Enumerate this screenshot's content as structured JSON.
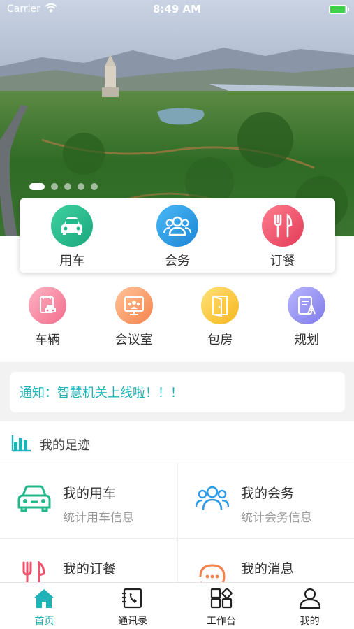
{
  "status_bar": {
    "carrier": "Carrier",
    "time": "8:49 AM"
  },
  "banner": {
    "slide_count": 5,
    "active_slide": 1
  },
  "main_services": [
    {
      "label": "用车",
      "icon": "car-icon",
      "color": "#22b98a"
    },
    {
      "label": "会务",
      "icon": "people-icon",
      "color": "#2d9ce8"
    },
    {
      "label": "订餐",
      "icon": "utensils-icon",
      "color": "#f0506a"
    }
  ],
  "sub_services": [
    {
      "label": "车辆",
      "icon": "vehicle-icon"
    },
    {
      "label": "会议室",
      "icon": "meeting-room-icon"
    },
    {
      "label": "包房",
      "icon": "door-icon"
    },
    {
      "label": "规划",
      "icon": "plan-icon"
    }
  ],
  "notice": {
    "text": "通知：智慧机关上线啦！！！"
  },
  "footprint": {
    "title": "我的足迹"
  },
  "records": [
    {
      "title": "我的用车",
      "subtitle": "统计用车信息",
      "icon": "car-outline-icon"
    },
    {
      "title": "我的会务",
      "subtitle": "统计会务信息",
      "icon": "people-outline-icon"
    },
    {
      "title": "我的订餐",
      "subtitle": "",
      "icon": "utensils-outline-icon"
    },
    {
      "title": "我的消息",
      "subtitle": "",
      "icon": "message-icon"
    }
  ],
  "tabs": [
    {
      "label": "首页",
      "icon": "home-icon",
      "active": true
    },
    {
      "label": "通讯录",
      "icon": "contacts-icon",
      "active": false
    },
    {
      "label": "工作台",
      "icon": "workbench-icon",
      "active": false
    },
    {
      "label": "我的",
      "icon": "profile-icon",
      "active": false
    }
  ],
  "colors": {
    "accent": "#1fb3b8",
    "green": "#22b98a",
    "blue": "#2d9ce8",
    "red": "#f0506a"
  }
}
